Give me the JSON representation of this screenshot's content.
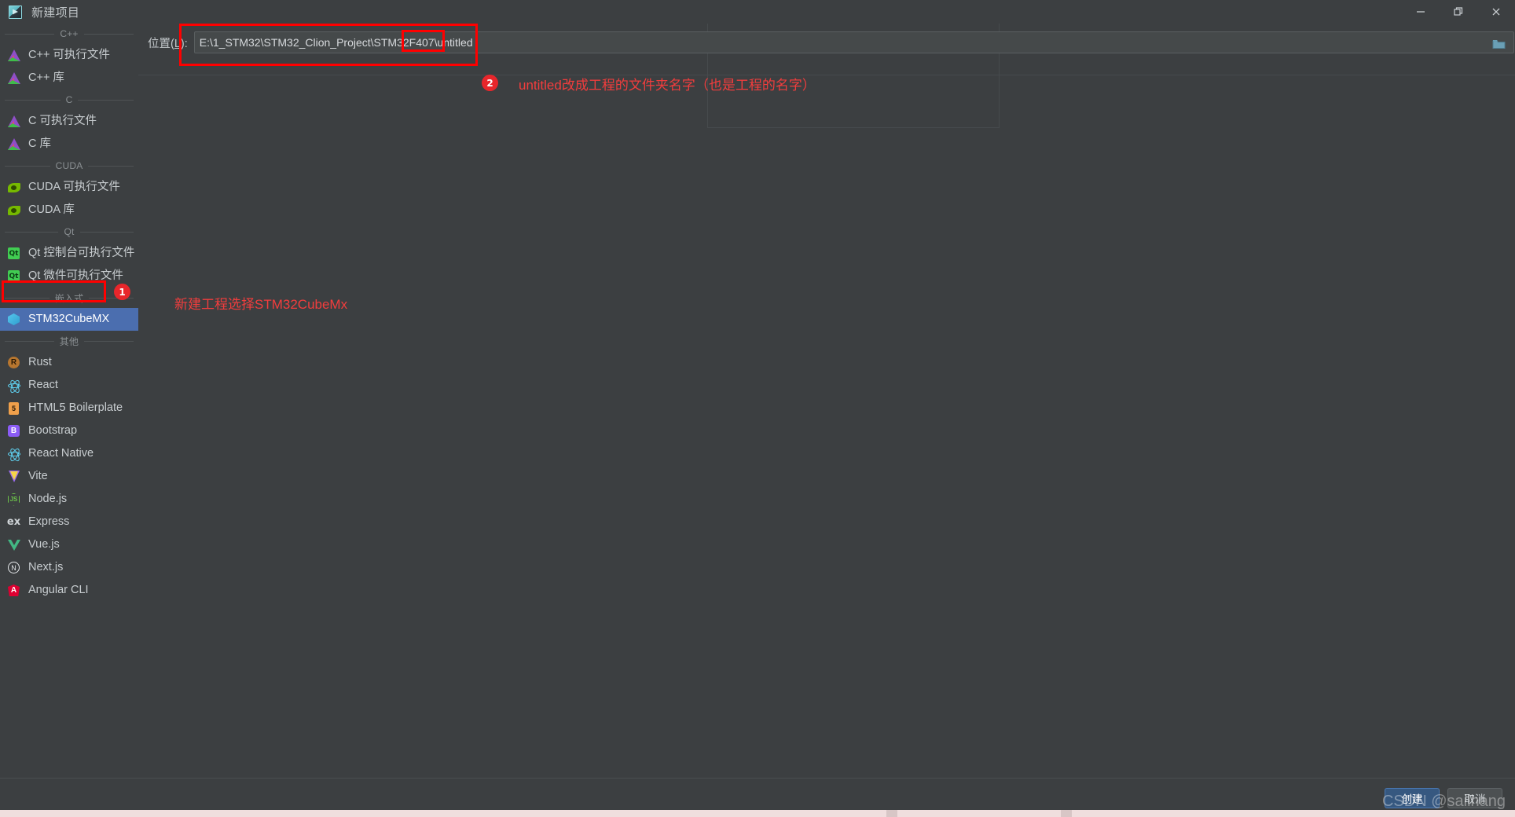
{
  "window": {
    "title": "新建项目",
    "icon": "new-project-icon",
    "controls": {
      "minimize": "—",
      "restore": "❐",
      "close": "✕"
    }
  },
  "sidebar": {
    "groups": [
      {
        "caption": "C++",
        "items": [
          {
            "label": "C++ 可执行文件",
            "icon": "clion-icon",
            "selected": false
          },
          {
            "label": "C++ 库",
            "icon": "clion-icon",
            "selected": false
          }
        ]
      },
      {
        "caption": "C",
        "items": [
          {
            "label": "C 可执行文件",
            "icon": "clion-icon",
            "selected": false
          },
          {
            "label": "C 库",
            "icon": "clion-icon",
            "selected": false
          }
        ]
      },
      {
        "caption": "CUDA",
        "items": [
          {
            "label": "CUDA 可执行文件",
            "icon": "cuda-icon",
            "selected": false
          },
          {
            "label": "CUDA 库",
            "icon": "cuda-icon",
            "selected": false
          }
        ]
      },
      {
        "caption": "Qt",
        "items": [
          {
            "label": "Qt 控制台可执行文件",
            "icon": "qt-icon",
            "selected": false
          },
          {
            "label": "Qt 微件可执行文件",
            "icon": "qt-icon",
            "selected": false
          }
        ]
      },
      {
        "caption": "嵌入式",
        "items": [
          {
            "label": "STM32CubeMX",
            "icon": "stm32-icon",
            "selected": true
          }
        ]
      },
      {
        "caption": "其他",
        "items": [
          {
            "label": "Rust",
            "icon": "rust-icon",
            "selected": false
          },
          {
            "label": "React",
            "icon": "react-icon",
            "selected": false
          },
          {
            "label": "HTML5 Boilerplate",
            "icon": "html5-icon",
            "selected": false
          },
          {
            "label": "Bootstrap",
            "icon": "bootstrap-icon",
            "selected": false
          },
          {
            "label": "React Native",
            "icon": "react-icon",
            "selected": false
          },
          {
            "label": "Vite",
            "icon": "vite-icon",
            "selected": false
          },
          {
            "label": "Node.js",
            "icon": "nodejs-icon",
            "selected": false
          },
          {
            "label": "Express",
            "icon": "express-icon",
            "selected": false
          },
          {
            "label": "Vue.js",
            "icon": "vuejs-icon",
            "selected": false
          },
          {
            "label": "Next.js",
            "icon": "nextjs-icon",
            "selected": false
          },
          {
            "label": "Angular CLI",
            "icon": "angular-icon",
            "selected": false
          }
        ]
      }
    ]
  },
  "form": {
    "location_label_pre": "位置(",
    "location_label_key": "L",
    "location_label_post": "):",
    "location_value": "E:\\1_STM32\\STM32_Clion_Project\\STM32F407\\untitled",
    "location_placeholder": "E:\\",
    "browse_icon": "folder-icon"
  },
  "annotations": [
    {
      "badge": "1",
      "text": "新建工程选择STM32CubeMx"
    },
    {
      "badge": "2",
      "text": "untitled改成工程的文件夹名字（也是工程的名字）"
    }
  ],
  "footer": {
    "create_label": "创建",
    "cancel_label": "取消"
  },
  "watermark": "CSDN @sailhang",
  "colors": {
    "background": "#3c3f41",
    "selection": "#4b6eaf",
    "annotation_red": "#f23d3d",
    "primary_button": "#365880"
  }
}
